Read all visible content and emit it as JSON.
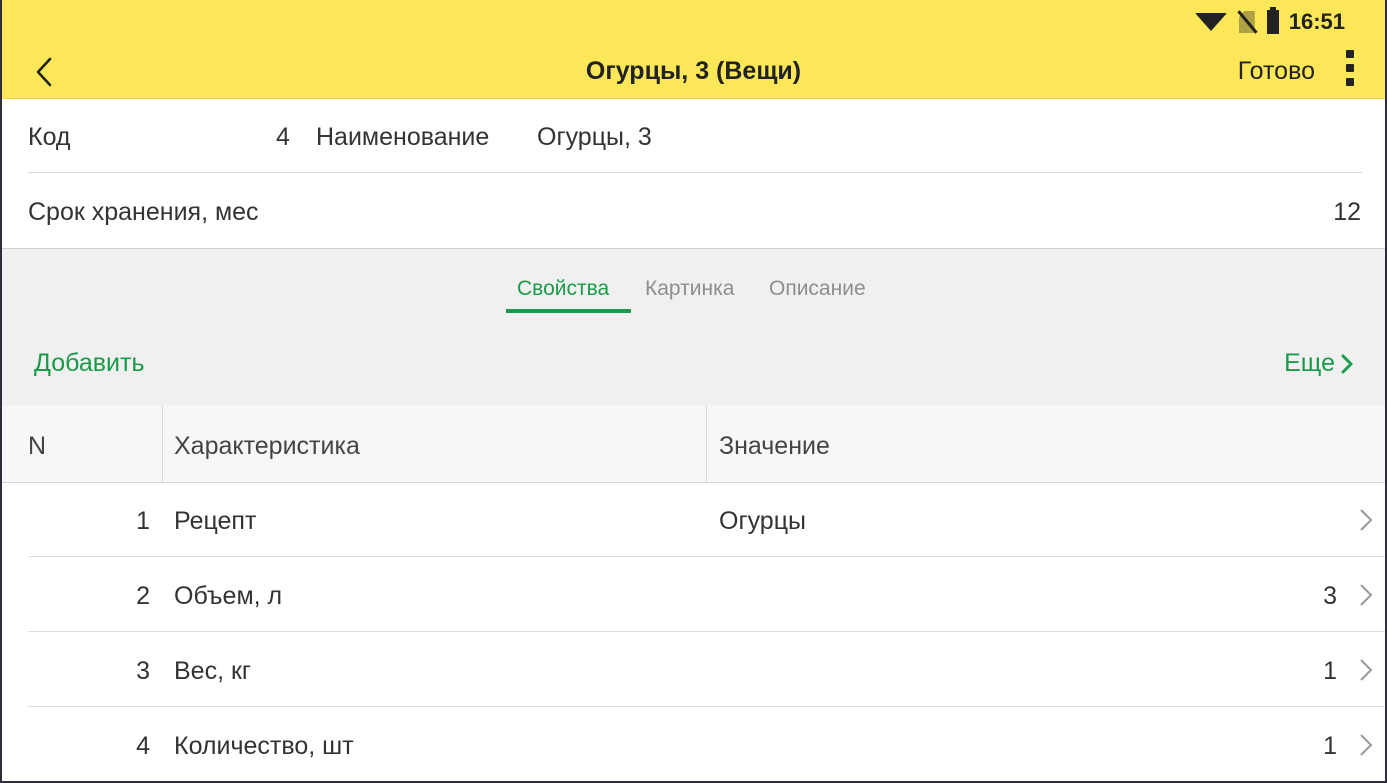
{
  "status_bar": {
    "time": "16:51",
    "icons": [
      "wifi-icon",
      "no-sim-icon",
      "battery-icon"
    ]
  },
  "header": {
    "title": "Огурцы,  3 (Вещи)",
    "done_label": "Готово",
    "back_icon": "chevron-left-icon",
    "menu_icon": "kebab-menu-icon",
    "background_color": "#fbe758"
  },
  "form": {
    "code_label": "Код",
    "code_value": "4",
    "name_label": "Наименование",
    "name_value": "Огурцы,  3",
    "shelf_life_label": "Срок хранения, мес",
    "shelf_life_value": "12"
  },
  "tabs": [
    {
      "label": "Свойства",
      "active": true
    },
    {
      "label": "Картинка",
      "active": false
    },
    {
      "label": "Описание",
      "active": false
    }
  ],
  "toolbar": {
    "add_label": "Добавить",
    "more_label": "Еще",
    "accent_color": "#1a9a4a"
  },
  "table": {
    "columns": [
      "N",
      "Характеристика",
      "Значение"
    ],
    "rows": [
      {
        "n": "1",
        "characteristic": "Рецепт",
        "value": "Огурцы"
      },
      {
        "n": "2",
        "characteristic": "Объем, л",
        "value": "3"
      },
      {
        "n": "3",
        "characteristic": "Вес, кг",
        "value": "1"
      },
      {
        "n": "4",
        "characteristic": "Количество, шт",
        "value": "1"
      }
    ]
  }
}
